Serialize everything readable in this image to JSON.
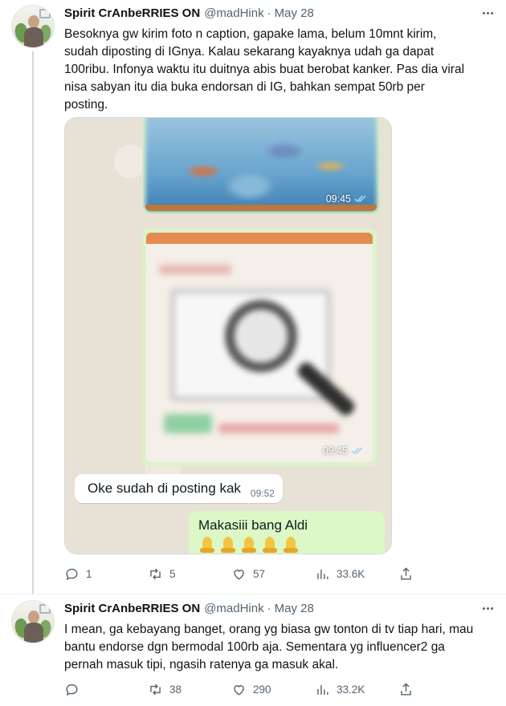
{
  "tweets": [
    {
      "author_name": "Spirit CrAnbeRRIES ON",
      "handle": "@madHink",
      "separator": "·",
      "date": "May 28",
      "text": "Besoknya gw kirim foto n caption, gapake lama, belum 10mnt kirim,\nsudah diposting di IGnya. Kalau sekarang kayaknya udah ga dapat\n100ribu. Infonya waktu itu duitnya abis buat berobat kanker. Pas dia viral\nnisa sabyan itu dia buka endorsan di IG, bahkan sempat 50rb per\nposting.",
      "media": {
        "image1_time": "09:45",
        "image2_time": "09:45",
        "incoming_message": "Oke sudah di posting kak",
        "incoming_time": "09:52",
        "outgoing_message": "Makasiii bang Aldi",
        "outgoing_emoji": "folded-hands-emoji"
      },
      "stats": {
        "replies": "1",
        "retweets": "5",
        "likes": "57",
        "views": "33.6K"
      }
    },
    {
      "author_name": "Spirit CrAnbeRRIES ON",
      "handle": "@madHink",
      "separator": "·",
      "date": "May 28",
      "text": "I mean, ga kebayang banget, orang yg biasa gw tonton di tv tiap hari, mau\nbantu endorse dgn bermodal 100rb aja. Sementara yg influencer2 ga\npernah masuk tipi, ngasih ratenya ga masuk akal.",
      "stats": {
        "replies": "",
        "retweets": "38",
        "likes": "290",
        "views": "33.2K"
      }
    }
  ],
  "colors": {
    "text": "#0f1419",
    "secondary": "#536471",
    "divider": "#eff3f4",
    "thread_line": "#cfd9de",
    "wa_outgoing": "#dcf8c6"
  },
  "icons": [
    "reply-icon",
    "retweet-icon",
    "like-icon",
    "views-icon",
    "share-icon",
    "more-icon",
    "read-ticks-icon"
  ]
}
